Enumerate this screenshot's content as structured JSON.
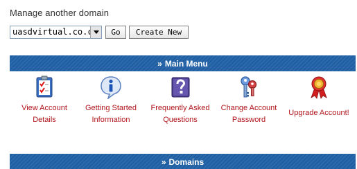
{
  "domain_manager": {
    "label": "Manage another domain",
    "selected_domain": "uasdvirtual.co.cc",
    "go_button": "Go",
    "create_button": "Create New"
  },
  "main_menu": {
    "prefix": "»",
    "title": "Main Menu",
    "items": [
      {
        "label": "View Account\nDetails",
        "icon": "checklist-icon"
      },
      {
        "label": "Getting Started\nInformation",
        "icon": "info-icon"
      },
      {
        "label": "Frequently Asked\nQuestions",
        "icon": "question-icon"
      },
      {
        "label": "Change Account\nPassword",
        "icon": "keys-icon"
      },
      {
        "label": "Upgrade Account!",
        "icon": "award-ribbon-icon"
      }
    ]
  },
  "domains_section": {
    "prefix": "»",
    "title": "Domains"
  },
  "colors": {
    "header_blue": "#1e5fa3",
    "link_red": "#b0141b"
  }
}
